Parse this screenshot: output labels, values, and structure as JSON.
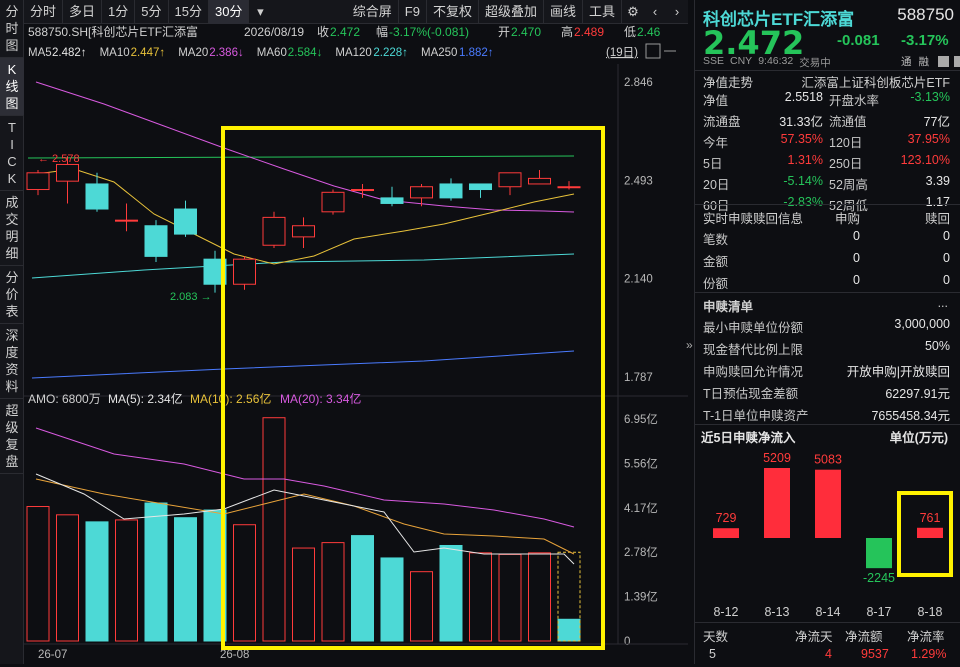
{
  "toolbar": {
    "tabs": [
      "分时",
      "多日",
      "1分",
      "5分",
      "15分",
      "30分"
    ],
    "dropdown_icon": "chevron-down-icon",
    "tools": [
      "综合屏",
      "F9",
      "不复权",
      "超级叠加",
      "画线",
      "工具"
    ],
    "icons": [
      "gear-icon",
      "chevron-left-icon",
      "chevron-right-icon"
    ]
  },
  "left_menu": [
    {
      "label": "分\n时\n图",
      "active": false
    },
    {
      "label": "K\n线\n图",
      "active": true
    },
    {
      "label": "T\nI\nC\nK",
      "active": false
    },
    {
      "label": "成\n交\n明\n细",
      "active": false
    },
    {
      "label": "分\n价\n表",
      "active": false
    },
    {
      "label": "深\n度\n资\n料",
      "active": false
    },
    {
      "label": "超\n级\n复\n盘",
      "active": false
    }
  ],
  "chart_header": {
    "symbol": "588750.SH[科创芯片ETF汇添富",
    "date": "2026/08/19",
    "close_label": "收",
    "close": "2.472",
    "range_label": "幅",
    "range": "-3.17%(-0.081)",
    "open_label": "开",
    "open": "2.470",
    "high_label": "高",
    "high": "2.489",
    "low_label": "低",
    "low": "2.46",
    "period_badge": "(19日)"
  },
  "ma_line": [
    {
      "label": "MA5",
      "value": "2.482↑",
      "color": "#e6e6e6"
    },
    {
      "label": "MA10",
      "value": "2.447↑",
      "color": "#e8c23a"
    },
    {
      "label": "MA20",
      "value": "2.386↓",
      "color": "#d85ae0"
    },
    {
      "label": "MA60",
      "value": "2.584↓",
      "color": "#25c45a"
    },
    {
      "label": "MA120",
      "value": "2.228↑",
      "color": "#4dd9d6"
    },
    {
      "label": "MA250",
      "value": "1.882↑",
      "color": "#4a7bff"
    }
  ],
  "price_axis": [
    "2.846",
    "2.493",
    "2.140",
    "1.787"
  ],
  "price_annotations": {
    "high_mark": "2.578",
    "low_mark": "2.083"
  },
  "vol_header": {
    "amo": "AMO: 6800万",
    "ma5": "MA(5): 2.34亿",
    "ma10": "MA(10): 2.56亿",
    "ma20": "MA(20): 3.34亿"
  },
  "vol_axis": [
    "6.95亿",
    "5.56亿",
    "4.17亿",
    "2.78亿",
    "1.39亿",
    "0"
  ],
  "date_axis": [
    "26-07",
    "26-08"
  ],
  "chart_data": {
    "type": "candlestick",
    "candles": [
      {
        "o": 2.46,
        "c": 2.52,
        "h": 2.53,
        "l": 2.44,
        "up": true
      },
      {
        "o": 2.49,
        "c": 2.55,
        "h": 2.58,
        "l": 2.41,
        "up": true
      },
      {
        "o": 2.48,
        "c": 2.39,
        "h": 2.52,
        "l": 2.38,
        "up": false
      },
      {
        "o": 2.35,
        "c": 2.35,
        "h": 2.41,
        "l": 2.31,
        "up": true
      },
      {
        "o": 2.33,
        "c": 2.22,
        "h": 2.35,
        "l": 2.2,
        "up": false
      },
      {
        "o": 2.39,
        "c": 2.3,
        "h": 2.42,
        "l": 2.29,
        "up": false
      },
      {
        "o": 2.21,
        "c": 2.12,
        "h": 2.24,
        "l": 2.09,
        "up": false
      },
      {
        "o": 2.12,
        "c": 2.21,
        "h": 2.22,
        "l": 2.1,
        "up": true
      },
      {
        "o": 2.26,
        "c": 2.36,
        "h": 2.38,
        "l": 2.25,
        "up": true
      },
      {
        "o": 2.29,
        "c": 2.33,
        "h": 2.36,
        "l": 2.25,
        "up": true
      },
      {
        "o": 2.38,
        "c": 2.45,
        "h": 2.46,
        "l": 2.37,
        "up": true
      },
      {
        "o": 2.46,
        "c": 2.46,
        "h": 2.48,
        "l": 2.43,
        "up": true
      },
      {
        "o": 2.43,
        "c": 2.41,
        "h": 2.47,
        "l": 2.4,
        "up": false
      },
      {
        "o": 2.43,
        "c": 2.47,
        "h": 2.48,
        "l": 2.4,
        "up": true
      },
      {
        "o": 2.48,
        "c": 2.43,
        "h": 2.5,
        "l": 2.42,
        "up": false
      },
      {
        "o": 2.48,
        "c": 2.46,
        "h": 2.48,
        "l": 2.43,
        "up": false
      },
      {
        "o": 2.47,
        "c": 2.52,
        "h": 2.52,
        "l": 2.44,
        "up": true
      },
      {
        "o": 2.48,
        "c": 2.5,
        "h": 2.53,
        "l": 2.48,
        "up": true
      },
      {
        "o": 2.47,
        "c": 2.47,
        "h": 2.49,
        "l": 2.46,
        "up": true
      }
    ],
    "volume": [
      4.21,
      3.95,
      3.73,
      3.79,
      4.32,
      3.86,
      4.1,
      3.64,
      6.99,
      2.91,
      3.08,
      3.3,
      2.6,
      2.17,
      2.99,
      2.76,
      2.71,
      2.76,
      0.68
    ],
    "vol_up": [
      true,
      true,
      false,
      true,
      false,
      false,
      false,
      true,
      true,
      true,
      true,
      false,
      false,
      true,
      false,
      true,
      true,
      true,
      false
    ],
    "vol_max": 6.95,
    "ylim": [
      1.787,
      2.846
    ]
  },
  "right": {
    "name": "科创芯片ETF汇添富",
    "code": "588750",
    "price": "2.472",
    "change": "-0.081",
    "change_pct": "-3.17%",
    "meta": [
      "SSE",
      "CNY",
      "9:46:32",
      "交易中"
    ],
    "badges": [
      "通",
      "融"
    ],
    "nav_title": "净值走势",
    "index_name": "汇添富上证科创板芯片ETF",
    "stats": [
      [
        "净值",
        "2.5518",
        "开盘水率",
        "-3.13%"
      ],
      [
        "流通盘",
        "31.33亿",
        "流通值",
        "77亿"
      ],
      [
        "今年",
        "57.35%",
        "120日",
        "37.95%"
      ],
      [
        "5日",
        "1.31%",
        "250日",
        "123.10%"
      ],
      [
        "20日",
        "-5.14%",
        "52周高",
        "3.39"
      ],
      [
        "60日",
        "-2.83%",
        "52周低",
        "1.17"
      ]
    ],
    "redeem_title": "实时申赎赎回信息",
    "redeem_cols": [
      "申购",
      "赎回"
    ],
    "redeem_rows": [
      [
        "笔数",
        "0",
        "0"
      ],
      [
        "金额",
        "0",
        "0"
      ],
      [
        "份额",
        "0",
        "0"
      ]
    ],
    "list_title": "申赎清单",
    "list_rows": [
      [
        "最小申赎单位份额",
        "3,000,000"
      ],
      [
        "现金替代比例上限",
        "50%"
      ],
      [
        "申购赎回允许情况",
        "开放申购|开放赎回"
      ],
      [
        "T日预估现金差额",
        "62297.91元"
      ],
      [
        "T-1日单位申赎资产",
        "7655458.34元"
      ]
    ],
    "flow_title": "近5日申赎净流入",
    "flow_unit": "单位(万元)",
    "flow_dates": [
      "8-12",
      "8-13",
      "8-14",
      "8-17",
      "8-18"
    ],
    "flow_values": [
      729,
      5209,
      5083,
      -2245,
      761
    ],
    "footer_labels": [
      "天数",
      "净流天",
      "净流额",
      "净流率"
    ],
    "footer_values": [
      "5",
      "4",
      "9537",
      "1.29%"
    ]
  }
}
